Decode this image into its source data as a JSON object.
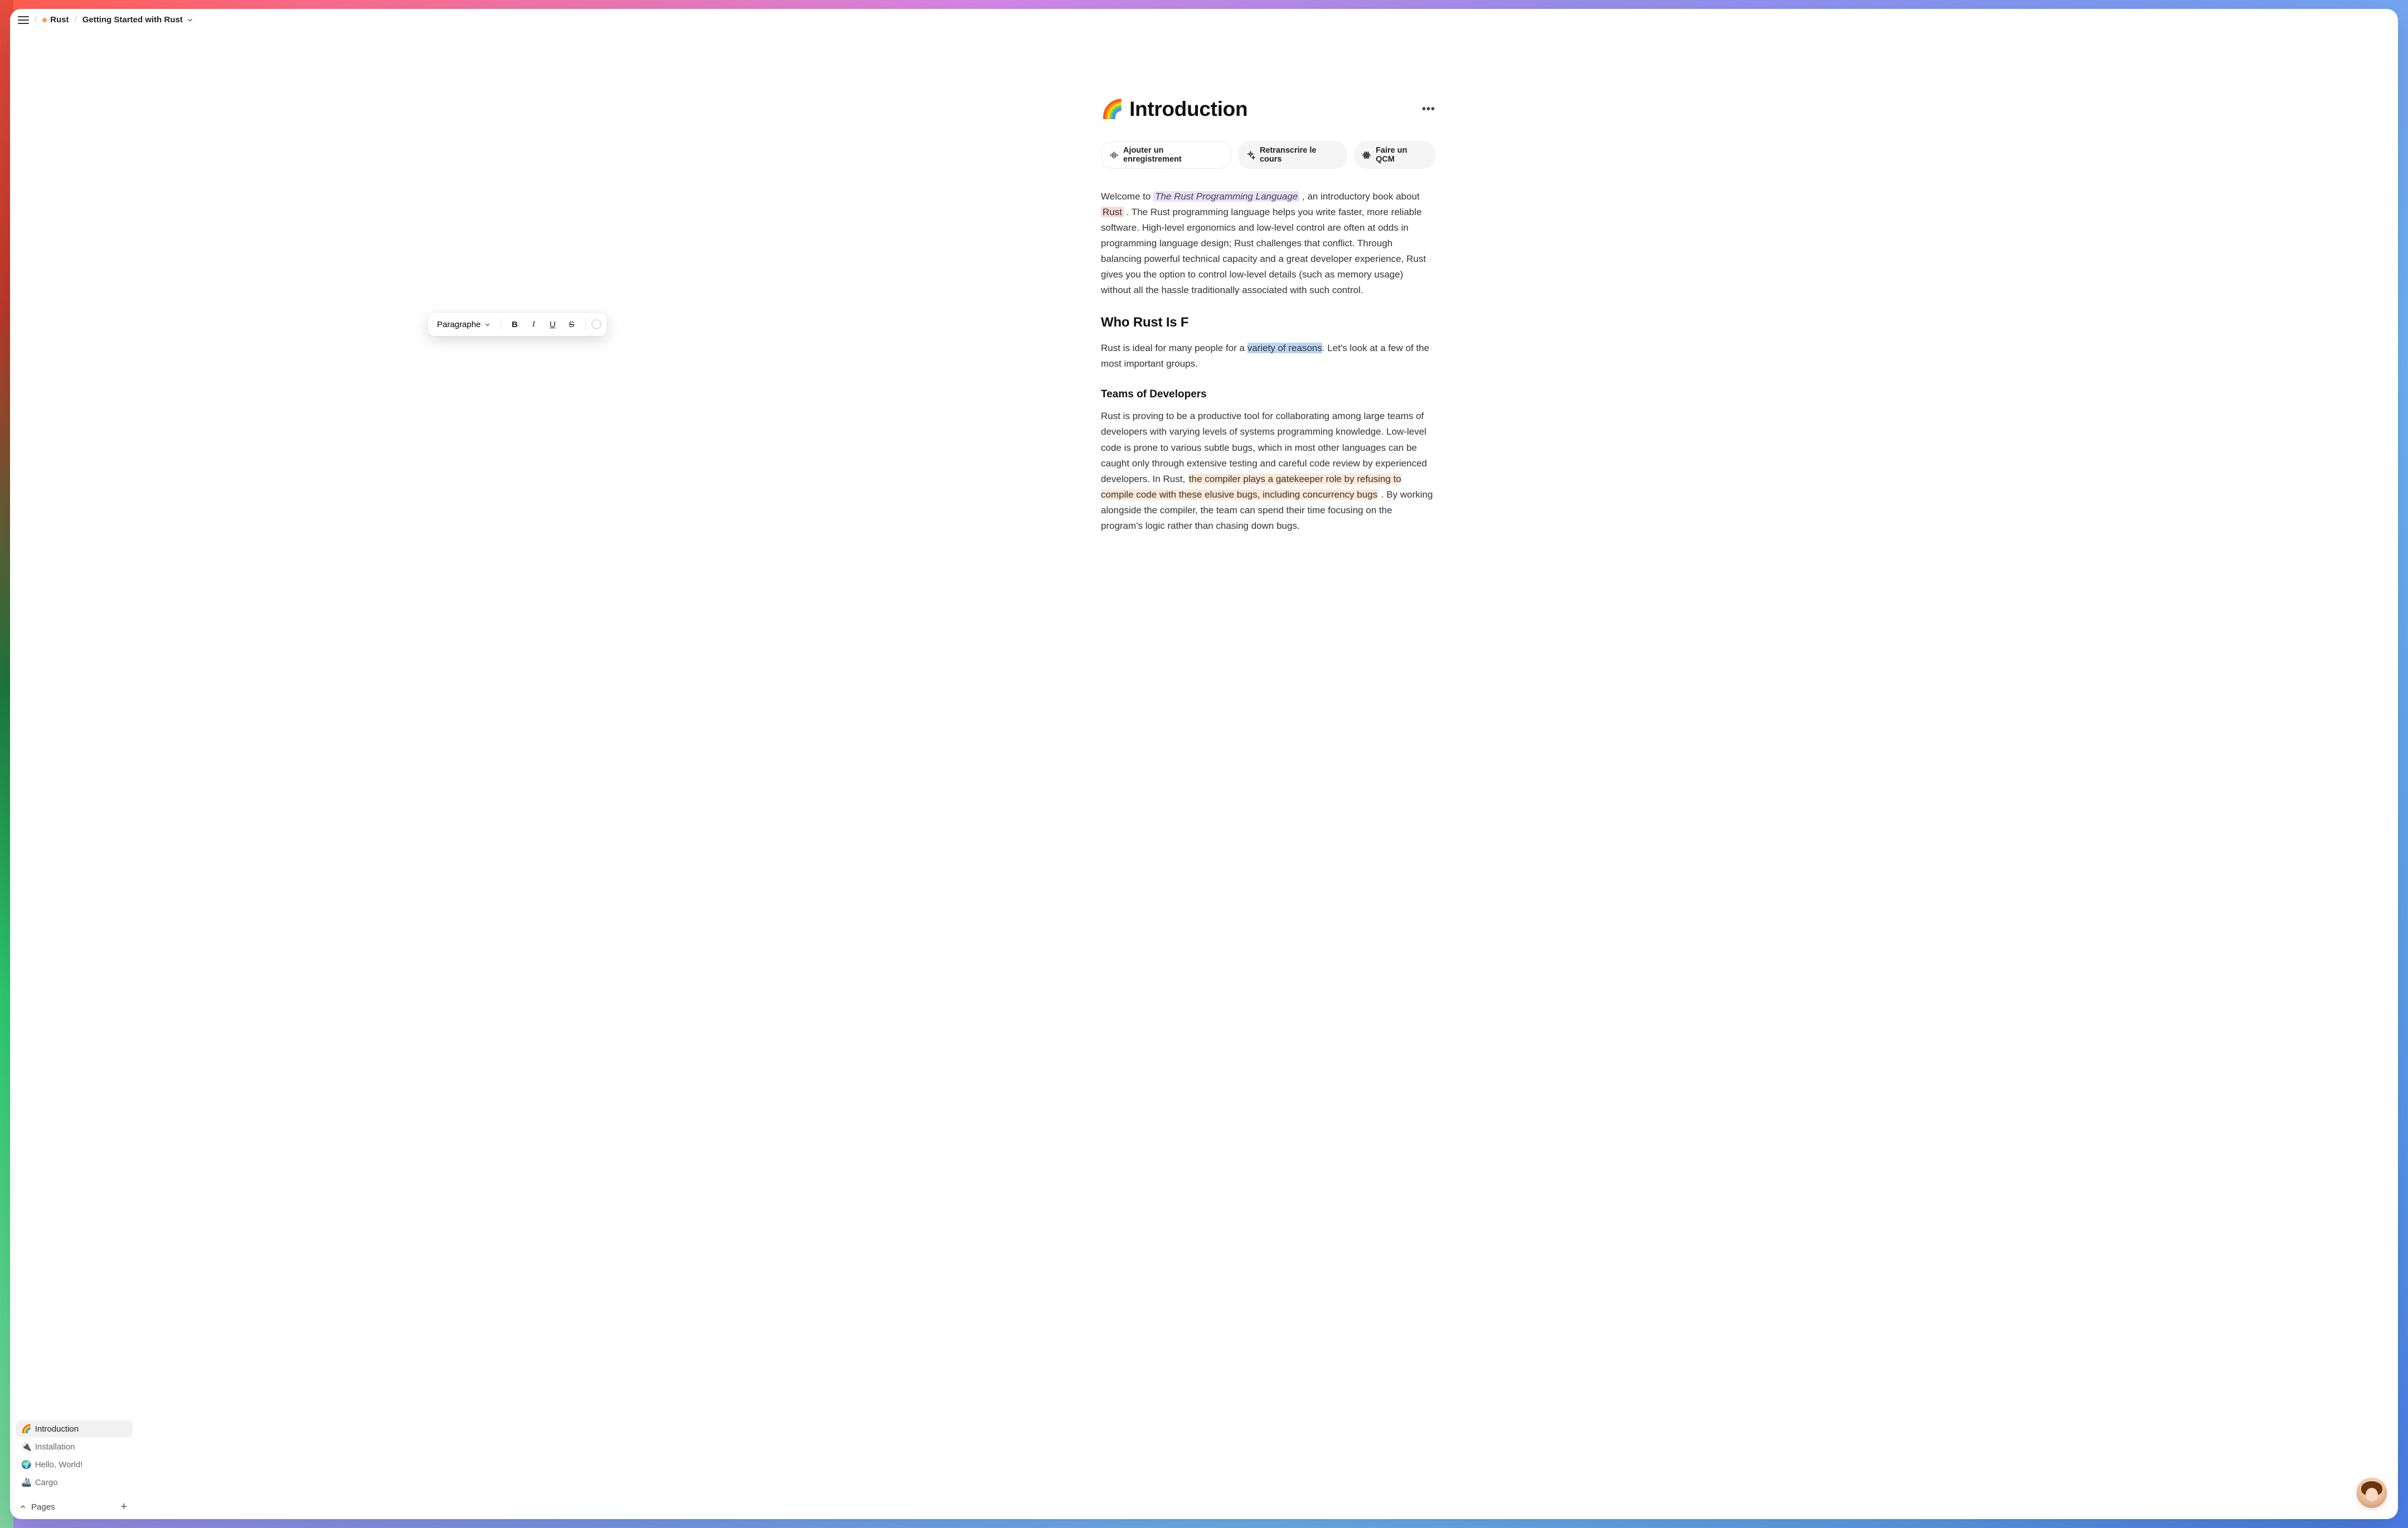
{
  "breadcrumb": {
    "parent_label": "Rust",
    "current_label": "Getting Started with Rust"
  },
  "sidebar": {
    "items": [
      {
        "emoji": "🌈",
        "label": "Introduction",
        "active": true
      },
      {
        "emoji": "🔌",
        "label": "Installation",
        "active": false
      },
      {
        "emoji": "🌍",
        "label": "Hello, World!",
        "active": false
      },
      {
        "emoji": "🚢",
        "label": "Cargo",
        "active": false
      }
    ],
    "footer_label": "Pages"
  },
  "document": {
    "emoji": "🌈",
    "title": "Introduction",
    "actions": {
      "record": "Ajouter un enregistrement",
      "retranscribe": "Retranscrire le cours",
      "quiz": "Faire un QCM"
    },
    "intro": {
      "pre": "Welcome to ",
      "book_name": "The Rust Programming Language",
      "mid": ", an introductory book about ",
      "rust_word": "Rust",
      "post": ". The Rust programming language helps you write faster, more reliable software. High-level ergonomics and low-level control are often at odds in programming language design; Rust challenges that conflict. Through balancing powerful technical capacity and a great developer experience, Rust gives you the option to control low-level details (such as memory usage) without all the hassle traditionally associated with such control."
    },
    "who_heading_visible": "Who Rust Is F",
    "who_para": {
      "pre": "Rust is ideal for many people for a ",
      "selected": "variety of reasons",
      "post": ". Let's look at a few of the most important groups."
    },
    "teams_heading": "Teams of Developers",
    "teams_para": {
      "pre": "Rust is proving to be a productive tool for collaborating among large teams of developers with varying levels of systems programming knowledge. Low-level code is prone to various subtle bugs, which in most other languages can be caught only through extensive testing and careful code review by experienced developers. In Rust, ",
      "hl": "the compiler plays a gatekeeper role by refusing to compile code with these elusive bugs, including concurrency bugs",
      "post": ". By working alongside the compiler, the team can spend their time focusing on the program's logic rather than chasing down bugs."
    }
  },
  "toolbar": {
    "type_label": "Paragraphe"
  }
}
